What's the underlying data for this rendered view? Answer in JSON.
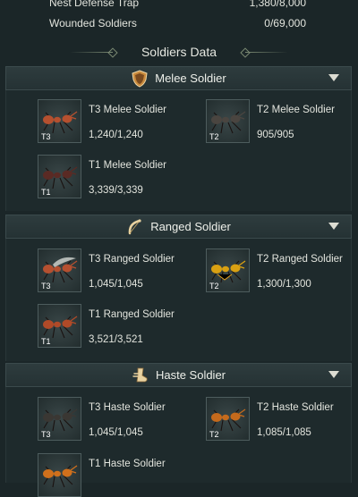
{
  "top_rows": [
    {
      "label": "Nest Defense Trap",
      "value": "1,380/8,000"
    },
    {
      "label": "Wounded Soldiers",
      "value": "0/69,000"
    }
  ],
  "section_title": "Soldiers Data",
  "panels": [
    {
      "title": "Melee Soldier",
      "icon": "shield-icon",
      "units": [
        {
          "name": "T3 Melee Soldier",
          "count": "1,240/1,240",
          "tier": "T3",
          "color": "#b5502f"
        },
        {
          "name": "T2 Melee Soldier",
          "count": "905/905",
          "tier": "T2",
          "color": "#4a4540"
        },
        {
          "name": "T1 Melee Soldier",
          "count": "3,339/3,339",
          "tier": "T1",
          "color": "#5a2a24"
        }
      ]
    },
    {
      "title": "Ranged Soldier",
      "icon": "bow-icon",
      "units": [
        {
          "name": "T3 Ranged Soldier",
          "count": "1,045/1,045",
          "tier": "T3",
          "color": "#b55030"
        },
        {
          "name": "T2 Ranged Soldier",
          "count": "1,300/1,300",
          "tier": "T2",
          "color": "#d9a012"
        },
        {
          "name": "T1 Ranged Soldier",
          "count": "3,521/3,521",
          "tier": "T1",
          "color": "#b04a28"
        }
      ]
    },
    {
      "title": "Haste Soldier",
      "icon": "boot-icon",
      "units": [
        {
          "name": "T3 Haste Soldier",
          "count": "1,045/1,045",
          "tier": "T3",
          "color": "#3a3733"
        },
        {
          "name": "T2 Haste Soldier",
          "count": "1,085/1,085",
          "tier": "T2",
          "color": "#c56a1c"
        },
        {
          "name": "T1 Haste Soldier",
          "count": "",
          "tier": "",
          "color": "#d0701c"
        }
      ]
    }
  ]
}
